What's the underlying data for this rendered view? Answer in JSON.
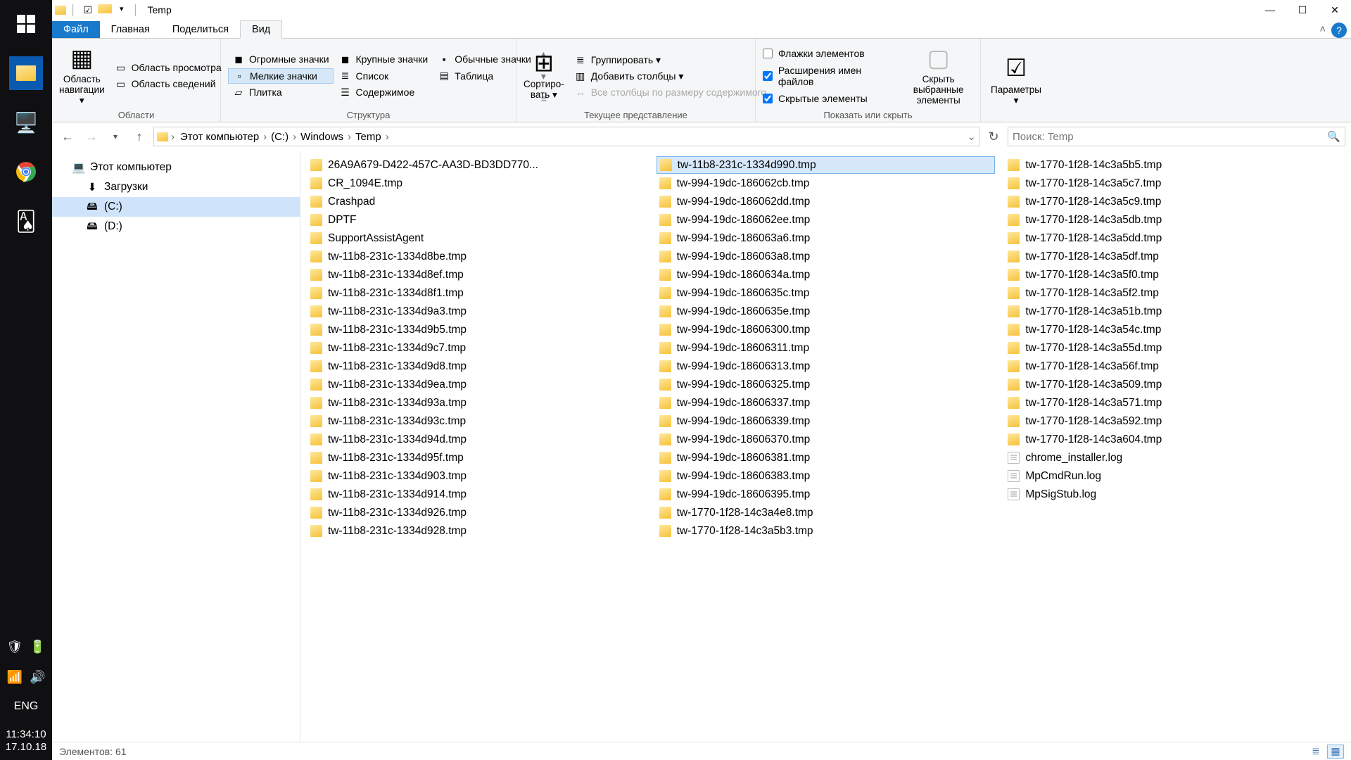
{
  "taskbar": {
    "lang": "ENG",
    "clock_time": "11:34:10",
    "clock_date": "17.10.18"
  },
  "title": {
    "app": "Temp"
  },
  "tabs": {
    "file": "Файл",
    "home": "Главная",
    "share": "Поделиться",
    "view": "Вид"
  },
  "ribbon": {
    "panes": {
      "nav_big": "Область навигации ▾",
      "preview": "Область просмотра",
      "details": "Область сведений",
      "group_label": "Области"
    },
    "layout": {
      "huge": "Огромные значки",
      "large": "Крупные значки",
      "normal": "Обычные значки",
      "small": "Мелкие значки",
      "list": "Список",
      "table": "Таблица",
      "tile": "Плитка",
      "content": "Содержимое",
      "group_label": "Структура"
    },
    "current": {
      "sort_big": "Сортиро-вать ▾",
      "groupby": "Группировать ▾",
      "addcol": "Добавить столбцы ▾",
      "autosize": "Все столбцы по размеру содержимого",
      "group_label": "Текущее представление"
    },
    "showhide": {
      "chk_boxes": "Флажки элементов",
      "chk_ext": "Расширения имен файлов",
      "chk_hidden": "Скрытые элементы",
      "hide_sel": "Скрыть выбранные элементы",
      "group_label": "Показать или скрыть"
    },
    "options": {
      "big": "Параметры ▾"
    }
  },
  "address": {
    "crumbs": [
      "Этот компьютер",
      "(C:)",
      "Windows",
      "Temp"
    ],
    "refresh": "↻"
  },
  "search": {
    "placeholder": "Поиск: Temp"
  },
  "nav": {
    "items": [
      {
        "icon": "💻",
        "label": "Этот компьютер",
        "indent": false,
        "sel": false
      },
      {
        "icon": "⬇",
        "label": "Загрузки",
        "indent": true,
        "sel": false
      },
      {
        "icon": "🖴",
        "label": "(C:)",
        "indent": true,
        "sel": true
      },
      {
        "icon": "🖴",
        "label": "(D:)",
        "indent": true,
        "sel": false
      }
    ]
  },
  "files": [
    [
      "26A9A679-D422-457C-AA3D-BD3DD770...",
      "f"
    ],
    [
      "CR_1094E.tmp",
      "f"
    ],
    [
      "Crashpad",
      "f"
    ],
    [
      "DPTF",
      "f"
    ],
    [
      "SupportAssistAgent",
      "f"
    ],
    [
      "tw-11b8-231c-1334d8be.tmp",
      "f"
    ],
    [
      "tw-11b8-231c-1334d8ef.tmp",
      "f"
    ],
    [
      "tw-11b8-231c-1334d8f1.tmp",
      "f"
    ],
    [
      "tw-11b8-231c-1334d9a3.tmp",
      "f"
    ],
    [
      "tw-11b8-231c-1334d9b5.tmp",
      "f"
    ],
    [
      "tw-11b8-231c-1334d9c7.tmp",
      "f"
    ],
    [
      "tw-11b8-231c-1334d9d8.tmp",
      "f"
    ],
    [
      "tw-11b8-231c-1334d9ea.tmp",
      "f"
    ],
    [
      "tw-11b8-231c-1334d93a.tmp",
      "f"
    ],
    [
      "tw-11b8-231c-1334d93c.tmp",
      "f"
    ],
    [
      "tw-11b8-231c-1334d94d.tmp",
      "f"
    ],
    [
      "tw-11b8-231c-1334d95f.tmp",
      "f"
    ],
    [
      "tw-11b8-231c-1334d903.tmp",
      "f"
    ],
    [
      "tw-11b8-231c-1334d914.tmp",
      "f"
    ],
    [
      "tw-11b8-231c-1334d926.tmp",
      "f"
    ],
    [
      "tw-11b8-231c-1334d928.tmp",
      "f"
    ],
    [
      "tw-11b8-231c-1334d990.tmp",
      "f",
      true
    ],
    [
      "tw-994-19dc-186062cb.tmp",
      "f"
    ],
    [
      "tw-994-19dc-186062dd.tmp",
      "f"
    ],
    [
      "tw-994-19dc-186062ee.tmp",
      "f"
    ],
    [
      "tw-994-19dc-186063a6.tmp",
      "f"
    ],
    [
      "tw-994-19dc-186063a8.tmp",
      "f"
    ],
    [
      "tw-994-19dc-1860634a.tmp",
      "f"
    ],
    [
      "tw-994-19dc-1860635c.tmp",
      "f"
    ],
    [
      "tw-994-19dc-1860635e.tmp",
      "f"
    ],
    [
      "tw-994-19dc-18606300.tmp",
      "f"
    ],
    [
      "tw-994-19dc-18606311.tmp",
      "f"
    ],
    [
      "tw-994-19dc-18606313.tmp",
      "f"
    ],
    [
      "tw-994-19dc-18606325.tmp",
      "f"
    ],
    [
      "tw-994-19dc-18606337.tmp",
      "f"
    ],
    [
      "tw-994-19dc-18606339.tmp",
      "f"
    ],
    [
      "tw-994-19dc-18606370.tmp",
      "f"
    ],
    [
      "tw-994-19dc-18606381.tmp",
      "f"
    ],
    [
      "tw-994-19dc-18606383.tmp",
      "f"
    ],
    [
      "tw-994-19dc-18606395.tmp",
      "f"
    ],
    [
      "tw-1770-1f28-14c3a4e8.tmp",
      "f"
    ],
    [
      "tw-1770-1f28-14c3a5b3.tmp",
      "f"
    ],
    [
      "tw-1770-1f28-14c3a5b5.tmp",
      "f"
    ],
    [
      "tw-1770-1f28-14c3a5c7.tmp",
      "f"
    ],
    [
      "tw-1770-1f28-14c3a5c9.tmp",
      "f"
    ],
    [
      "tw-1770-1f28-14c3a5db.tmp",
      "f"
    ],
    [
      "tw-1770-1f28-14c3a5dd.tmp",
      "f"
    ],
    [
      "tw-1770-1f28-14c3a5df.tmp",
      "f"
    ],
    [
      "tw-1770-1f28-14c3a5f0.tmp",
      "f"
    ],
    [
      "tw-1770-1f28-14c3a5f2.tmp",
      "f"
    ],
    [
      "tw-1770-1f28-14c3a51b.tmp",
      "f"
    ],
    [
      "tw-1770-1f28-14c3a54c.tmp",
      "f"
    ],
    [
      "tw-1770-1f28-14c3a55d.tmp",
      "f"
    ],
    [
      "tw-1770-1f28-14c3a56f.tmp",
      "f"
    ],
    [
      "tw-1770-1f28-14c3a509.tmp",
      "f"
    ],
    [
      "tw-1770-1f28-14c3a571.tmp",
      "f"
    ],
    [
      "tw-1770-1f28-14c3a592.tmp",
      "f"
    ],
    [
      "tw-1770-1f28-14c3a604.tmp",
      "f"
    ],
    [
      "chrome_installer.log",
      "t"
    ],
    [
      "MpCmdRun.log",
      "t"
    ],
    [
      "MpSigStub.log",
      "t"
    ]
  ],
  "status": {
    "count_label": "Элементов:",
    "count": "61"
  }
}
